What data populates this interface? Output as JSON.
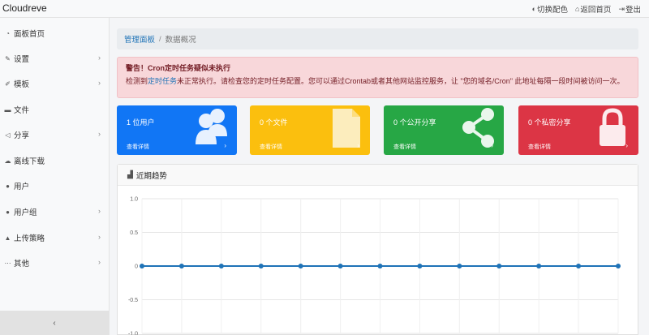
{
  "app": {
    "brand": "Cloudreve"
  },
  "topnav": {
    "theme_label": "切换配色",
    "home_label": "返回首页",
    "logout_label": "登出"
  },
  "sidebar": {
    "items": [
      {
        "label": "面板首页",
        "icon": "dashboard-icon",
        "has_children": false
      },
      {
        "label": "设置",
        "icon": "wrench-icon",
        "has_children": true
      },
      {
        "label": "模板",
        "icon": "paint-brush-icon",
        "has_children": true
      },
      {
        "label": "文件",
        "icon": "folder-icon",
        "has_children": false
      },
      {
        "label": "分享",
        "icon": "share-icon",
        "has_children": true
      },
      {
        "label": "离线下载",
        "icon": "cloud-download-icon",
        "has_children": false
      },
      {
        "label": "用户",
        "icon": "user-icon",
        "has_children": false
      },
      {
        "label": "用户组",
        "icon": "users-icon",
        "has_children": true
      },
      {
        "label": "上传策略",
        "icon": "upload-icon",
        "has_children": true
      },
      {
        "label": "其他",
        "icon": "ellipsis-icon",
        "has_children": true
      }
    ],
    "collapse_icon": "chevron-left-icon"
  },
  "breadcrumb": {
    "parent": "管理面板",
    "separator": "/",
    "current": "数据概况"
  },
  "alert": {
    "title": "警告！Cron定时任务疑似未执行",
    "text_before": "检测到",
    "link": "定时任务",
    "text_after": "未正常执行。请检查您的定时任务配置。您可以通过Crontab或者其他网站监控服务，让 \"您的域名/Cron\" 此地址每隔一段时间被访问一次。"
  },
  "cards": [
    {
      "title": "1 位用户",
      "link": "查看详情",
      "icon": "users-icon",
      "color": "#1176f5"
    },
    {
      "title": "0 个文件",
      "link": "查看详情",
      "icon": "file-icon",
      "color": "#fbbf0e"
    },
    {
      "title": "0 个公开分享",
      "link": "查看详情",
      "icon": "share-icon",
      "color": "#27a745"
    },
    {
      "title": "0 个私密分享",
      "link": "查看详情",
      "icon": "lock-icon",
      "color": "#dc3545"
    }
  ],
  "trend_panel": {
    "title": "近期趋势",
    "icon": "area-chart-icon"
  },
  "chart_data": {
    "type": "line",
    "title": "",
    "xlabel": "",
    "ylabel": "",
    "ylim": [
      -1.0,
      1.0
    ],
    "y_ticks": [
      "1.0",
      "0.5",
      "0",
      "-0.5",
      "-1.0"
    ],
    "grid": true,
    "series": [
      {
        "values": [
          0,
          0,
          0,
          0,
          0,
          0,
          0,
          0,
          0,
          0,
          0,
          0,
          0
        ],
        "color": "#1f73b7"
      }
    ]
  }
}
